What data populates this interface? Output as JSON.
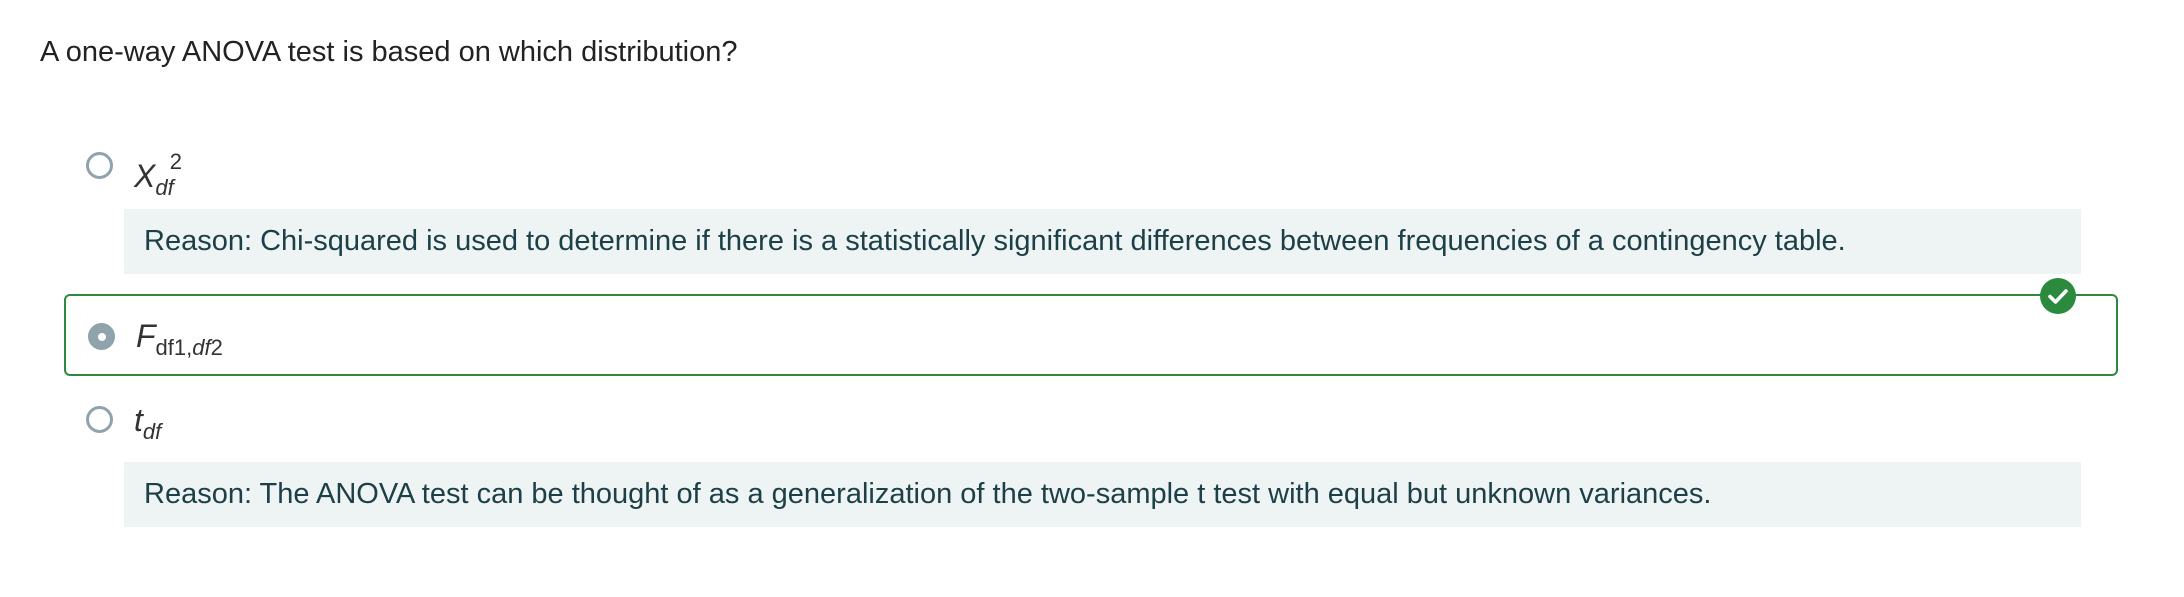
{
  "question": "A one-way ANOVA test is based on which distribution?",
  "options": [
    {
      "symbol": "X",
      "subscript": "df",
      "superscript": "2",
      "selected": false,
      "reason": "Reason: Chi-squared is used to determine if there is a statistically significant differences between frequencies of a contingency table."
    },
    {
      "symbol": "F",
      "subscript_part1": "df1,",
      "subscript_part2": "df",
      "subscript_part3": "2",
      "selected": true,
      "correct": true
    },
    {
      "symbol": "t",
      "subscript": "df",
      "selected": false,
      "reason": "Reason: The ANOVA test can be thought of as a generalization of the two-sample t test with equal but unknown variances."
    }
  ],
  "colors": {
    "correct": "#2b8a3e",
    "radio": "#8ea3ab",
    "reason_bg": "#eef3f3",
    "reason_text": "#1d4048"
  },
  "icons": {
    "correct_badge": "check-circle-icon"
  }
}
